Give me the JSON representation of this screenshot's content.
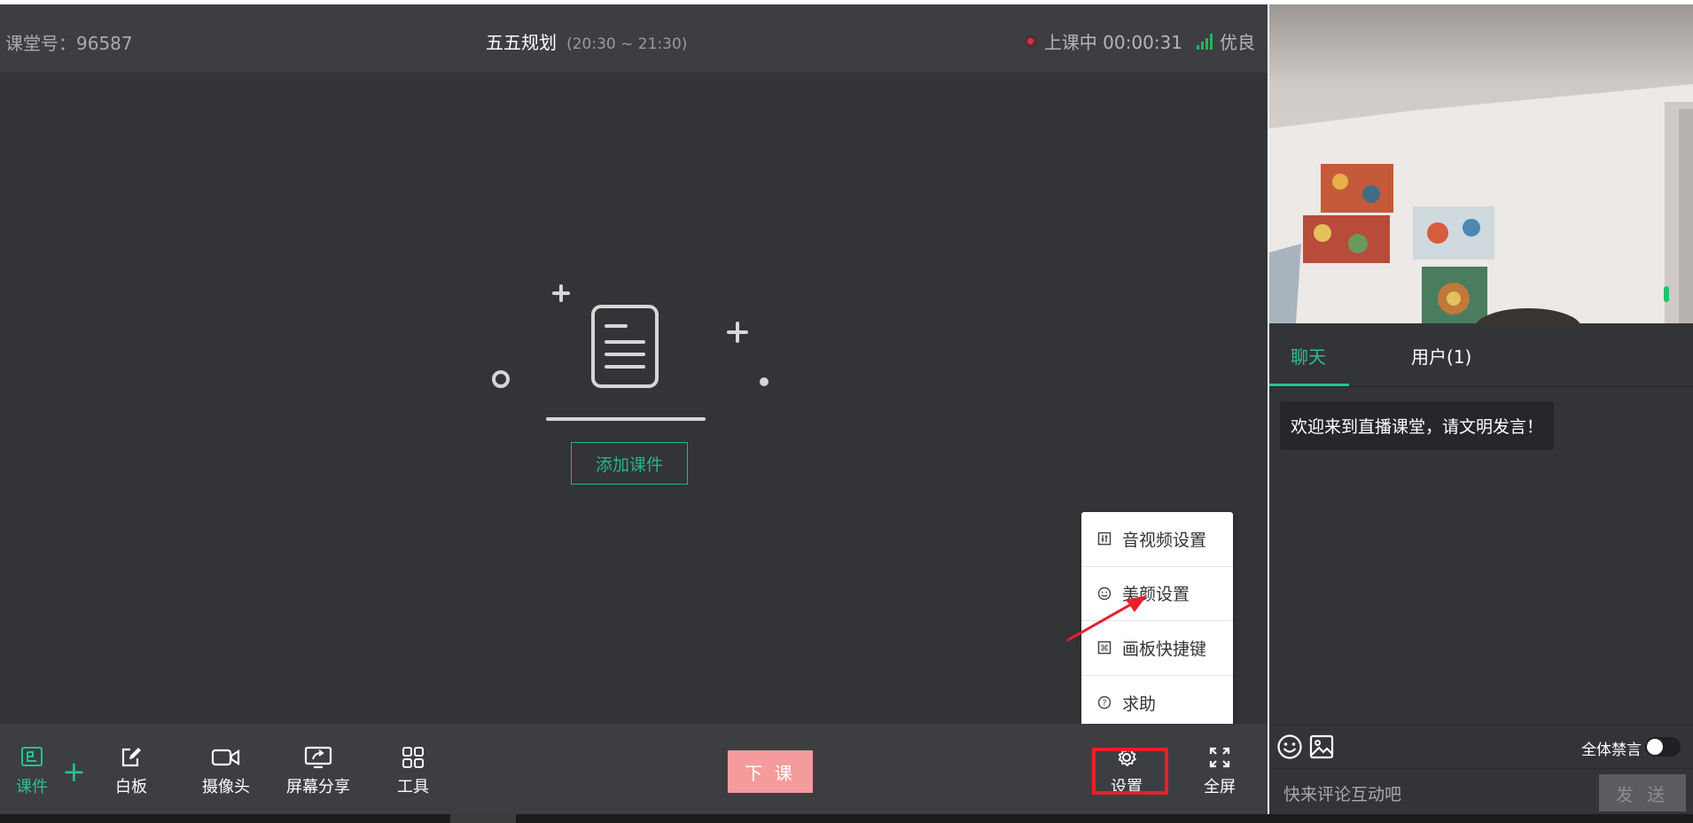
{
  "header": {
    "room_number": "课堂号：96587",
    "title": "五五规划",
    "time_range": "(20:30 ~ 21:30)",
    "class_status": "上课中 00:00:31",
    "network_quality": "优良"
  },
  "stage": {
    "add_courseware_label": "添加课件"
  },
  "settings_menu": {
    "items": [
      {
        "icon": "av-settings-icon",
        "label": "音视频设置"
      },
      {
        "icon": "beauty-icon",
        "label": "美颜设置"
      },
      {
        "icon": "shortcut-icon",
        "label": "画板快捷键"
      },
      {
        "icon": "help-icon",
        "label": "求助"
      }
    ]
  },
  "toolbar": {
    "courseware": "课件",
    "whiteboard": "白板",
    "camera": "摄像头",
    "screen_share": "屏幕分享",
    "tools": "工具",
    "end_class": "下 课",
    "settings": "设置",
    "fullscreen": "全屏"
  },
  "chat_panel": {
    "tabs": [
      {
        "label": "聊天",
        "active": true
      },
      {
        "label": "用户(1)",
        "active": false
      }
    ],
    "messages": [
      "欢迎来到直播课堂，请文明发言！"
    ],
    "mute_all_label": "全体禁言",
    "mute_all_on": false,
    "input_placeholder": "快来评论互动吧",
    "send_label": "发 送"
  },
  "colors": {
    "accent": "#2cc08e",
    "end_button": "#f59b9b",
    "highlight_box": "#e8202a",
    "recording_dot": "#ea2d3d",
    "signal": "#20b85a"
  }
}
